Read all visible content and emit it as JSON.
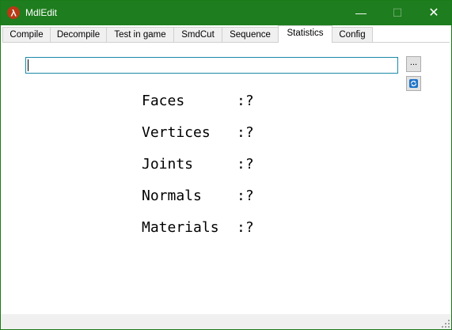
{
  "window": {
    "title": "MdlEdit",
    "minimize": "—",
    "maximize": "☐",
    "close": "✕"
  },
  "tabs": [
    {
      "label": "Compile"
    },
    {
      "label": "Decompile"
    },
    {
      "label": "Test in game"
    },
    {
      "label": "SmdCut"
    },
    {
      "label": "Sequence"
    },
    {
      "label": "Statistics",
      "active": true
    },
    {
      "label": "Config"
    }
  ],
  "path": {
    "value": "",
    "browse_label": "..."
  },
  "stats": [
    {
      "label": "Faces",
      "value": ":?"
    },
    {
      "label": "Vertices",
      "value": ":?"
    },
    {
      "label": "Joints",
      "value": ":?"
    },
    {
      "label": "Normals",
      "value": ":?"
    },
    {
      "label": "Materials",
      "value": ":?"
    }
  ],
  "colors": {
    "titlebar": "#1e7d1e",
    "input_border": "#1b8aa8",
    "refresh_icon": "#1e73c8"
  }
}
